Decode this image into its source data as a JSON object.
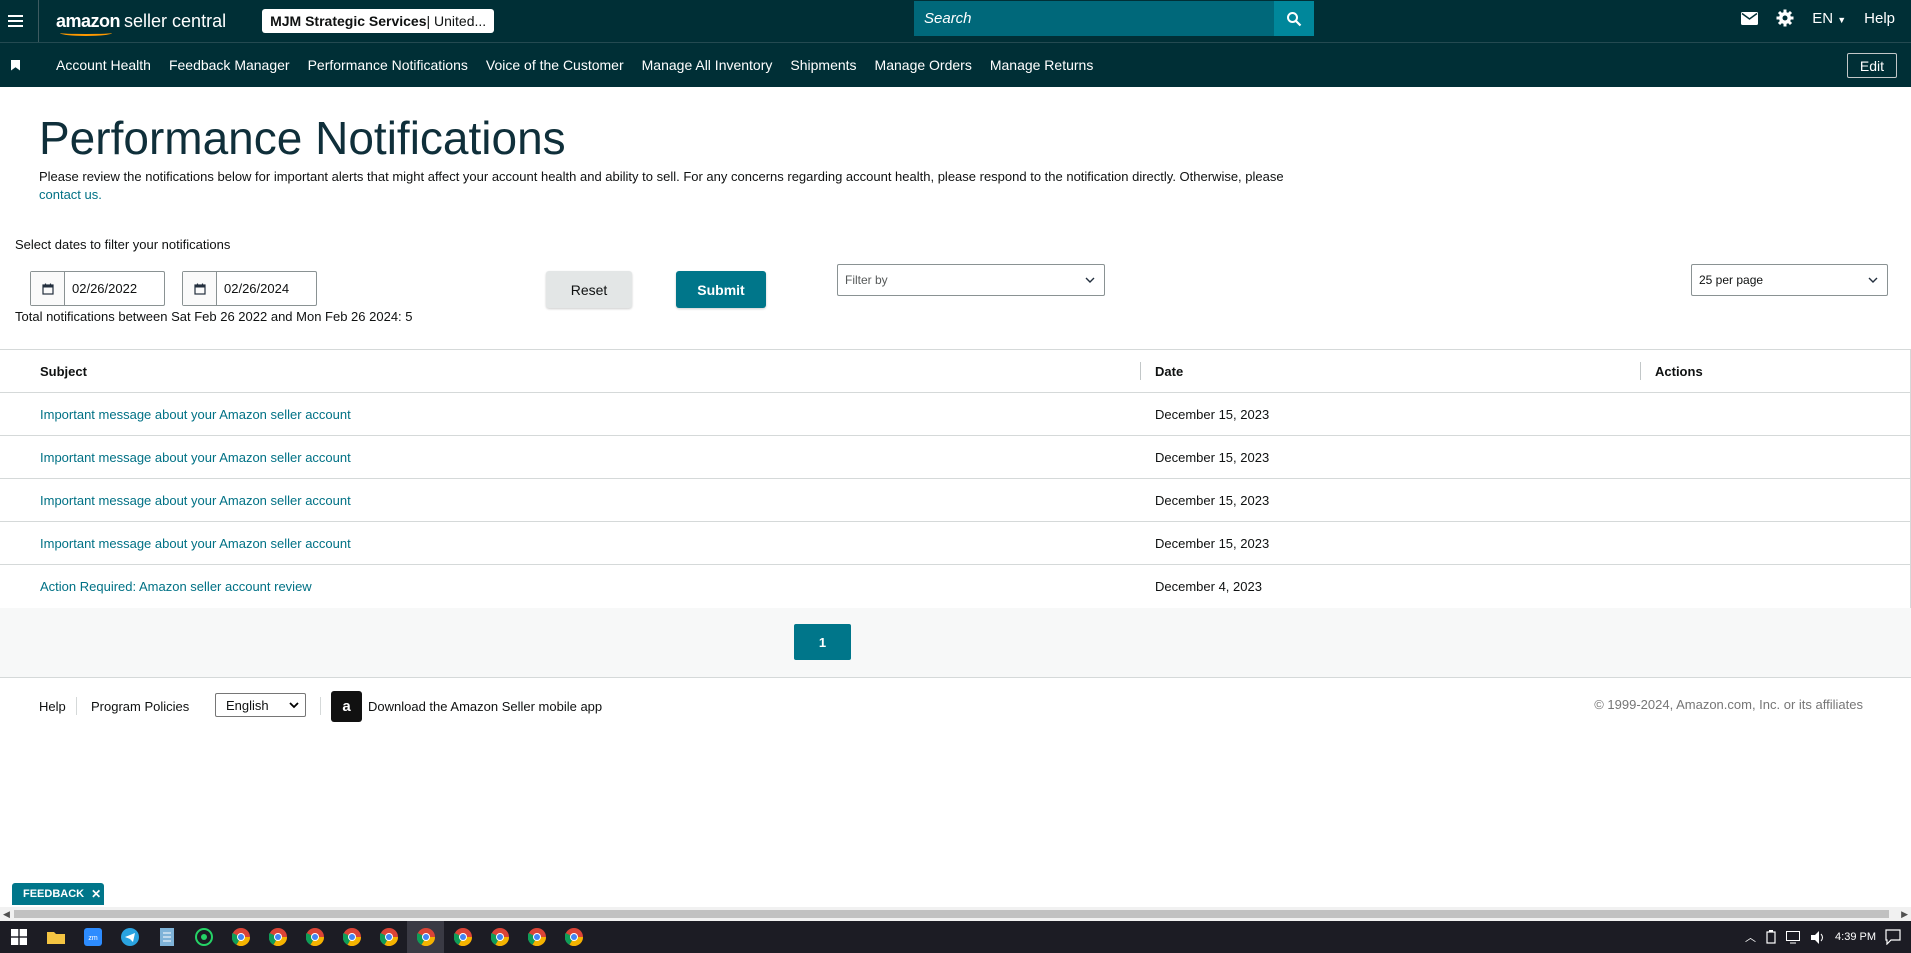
{
  "topbar": {
    "logo_main": "amazon",
    "logo_sub": "seller central",
    "account_name": "MJM Strategic Services",
    "account_region": " | United...",
    "search_placeholder": "Search",
    "language": "EN",
    "help": "Help"
  },
  "navbar": {
    "items": [
      "Account Health",
      "Feedback Manager",
      "Performance Notifications",
      "Voice of the Customer",
      "Manage All Inventory",
      "Shipments",
      "Manage Orders",
      "Manage Returns"
    ],
    "edit": "Edit"
  },
  "page": {
    "title": "Performance Notifications",
    "intro": "Please review the notifications below for important alerts that might affect your account health and ability to sell. For any concerns regarding account health, please respond to the notification directly. Otherwise, please ",
    "intro_link": "contact us.",
    "filter_label": "Select dates to filter your notifications",
    "date_from": "02/26/2022",
    "date_to": "02/26/2024",
    "reset": "Reset",
    "submit": "Submit",
    "filter_by": "Filter by",
    "per_page": "25 per page",
    "total": "Total notifications between Sat Feb 26 2022 and Mon Feb 26 2024: 5"
  },
  "table": {
    "headers": {
      "subject": "Subject",
      "date": "Date",
      "actions": "Actions"
    },
    "rows": [
      {
        "subject": "Important message about your Amazon seller account",
        "date": "December 15, 2023"
      },
      {
        "subject": "Important message about your Amazon seller account",
        "date": "December 15, 2023"
      },
      {
        "subject": "Important message about your Amazon seller account",
        "date": "December 15, 2023"
      },
      {
        "subject": "Important message about your Amazon seller account",
        "date": "December 15, 2023"
      },
      {
        "subject": "Action Required: Amazon seller account review",
        "date": "December 4, 2023"
      }
    ]
  },
  "pagination": {
    "current": "1"
  },
  "footer": {
    "help": "Help",
    "policies": "Program Policies",
    "language": "English",
    "download": "Download the Amazon Seller mobile app",
    "copyright": "© 1999-2024, Amazon.com, Inc. or its affiliates"
  },
  "feedback": {
    "label": "FEEDBACK",
    "close": "✕"
  },
  "taskbar": {
    "time": "4:39 PM",
    "apps": [
      "file-explorer",
      "zoom",
      "telegram",
      "notepad",
      "whatsapp",
      "chrome",
      "chrome",
      "chrome",
      "chrome",
      "chrome",
      "chrome",
      "chrome",
      "chrome",
      "chrome",
      "chrome"
    ]
  },
  "colors": {
    "header_bg": "#002f36",
    "search_bg": "#00687a",
    "accent": "#00768a",
    "link": "#007185"
  }
}
